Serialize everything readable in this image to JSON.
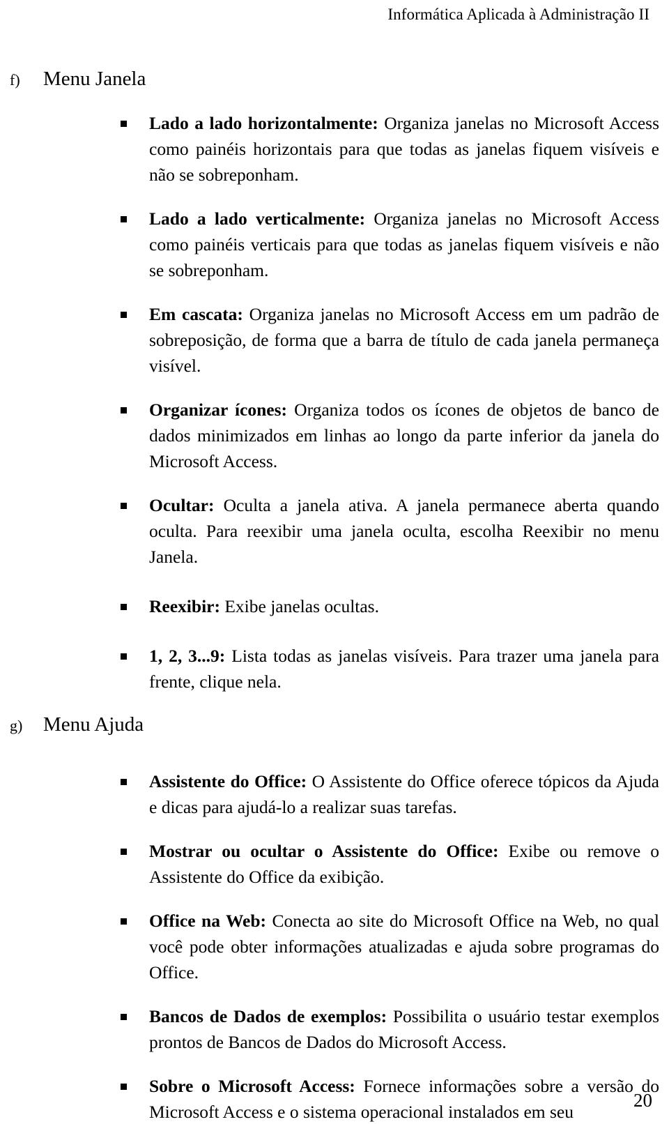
{
  "header": {
    "running_title": "Informática Aplicada à Administração II"
  },
  "footer": {
    "page_number": "20"
  },
  "sections": [
    {
      "marker": "f)",
      "title": "Menu Janela",
      "items": [
        {
          "term": "Lado a lado horizontalmente:",
          "definition": " Organiza janelas no Microsoft Access como painéis horizontais para que todas as janelas fiquem visíveis e não se sobreponham."
        },
        {
          "term": "Lado a lado verticalmente:",
          "definition": " Organiza janelas no Microsoft Access como painéis verticais para que todas as janelas fiquem visíveis e não se sobreponham."
        },
        {
          "term": "Em cascata:",
          "definition": " Organiza janelas no Microsoft Access em um padrão de sobreposição, de forma que a barra de título de cada janela permaneça visível."
        },
        {
          "term": "Organizar ícones:",
          "definition": " Organiza todos os ícones de objetos de banco de dados minimizados em linhas ao longo da parte inferior da janela do Microsoft Access."
        },
        {
          "term": "Ocultar:",
          "definition": " Oculta a janela ativa. A janela permanece aberta quando oculta. Para reexibir uma janela oculta, escolha Reexibir no menu Janela."
        },
        {
          "term": "Reexibir:",
          "definition": " Exibe janelas ocultas."
        },
        {
          "term": "1, 2, 3...9:",
          "definition": " Lista todas as janelas visíveis. Para trazer uma janela para frente, clique nela."
        }
      ]
    },
    {
      "marker": "g)",
      "title": "Menu Ajuda",
      "items": [
        {
          "term": "Assistente do Office:",
          "definition": " O Assistente do Office oferece tópicos da Ajuda e dicas para ajudá-lo a realizar suas tarefas."
        },
        {
          "term": "Mostrar ou ocultar o Assistente do Office:",
          "definition": " Exibe ou remove o Assistente do Office da exibição."
        },
        {
          "term": "Office na Web:",
          "definition": " Conecta ao site do Microsoft Office na Web, no qual você pode obter informações atualizadas e ajuda sobre programas do Office."
        },
        {
          "term": "Bancos de Dados de exemplos:",
          "definition": " Possibilita o usuário testar exemplos prontos de Bancos de Dados do Microsoft Access."
        },
        {
          "term": "Sobre o Microsoft Access:",
          "definition": " Fornece informações sobre a versão do Microsoft Access e o sistema operacional instalados em seu"
        }
      ]
    }
  ]
}
